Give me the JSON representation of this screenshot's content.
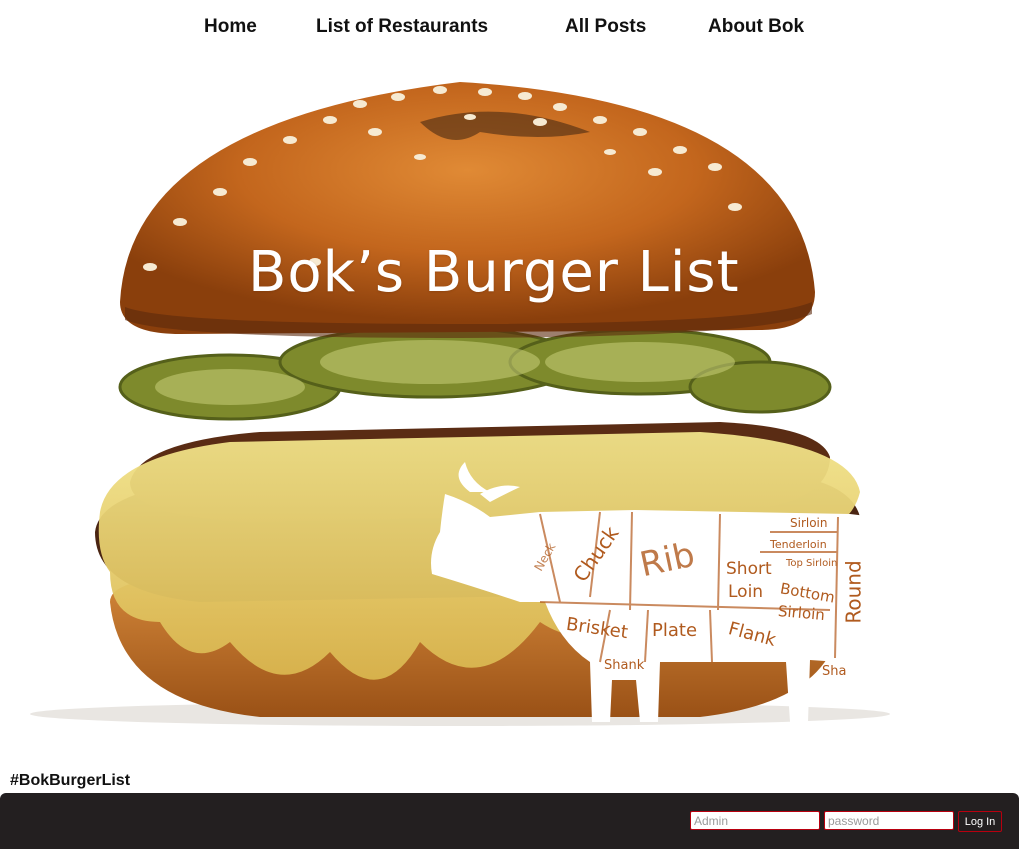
{
  "nav": {
    "items": [
      {
        "label": "Home"
      },
      {
        "label": "List of Restaurants"
      },
      {
        "label": "All Posts"
      },
      {
        "label": "About Bok"
      }
    ]
  },
  "hero": {
    "title": "Bok’s Burger List",
    "cow_labels": {
      "neck": "Neck",
      "chuck": "Chuck",
      "rib": "Rib",
      "short_loin_1": "Short",
      "short_loin_2": "Loin",
      "sirloin": "Sirloin",
      "tenderloin": "Tenderloin",
      "top_sirloin": "Top Sirloin",
      "bottom_sirloin_1": "Bottom",
      "bottom_sirloin_2": "Sirloin",
      "round": "Round",
      "brisket": "Brisket",
      "plate": "Plate",
      "flank": "Flank",
      "shank": "Shank",
      "shank_partial": "Sha"
    }
  },
  "hashtag": "#BokBurgerList",
  "login": {
    "admin_placeholder": "Admin",
    "password_placeholder": "password",
    "button_label": "Log In"
  },
  "colors": {
    "footer_bg": "#231f20",
    "accent_border": "#b8000f"
  }
}
